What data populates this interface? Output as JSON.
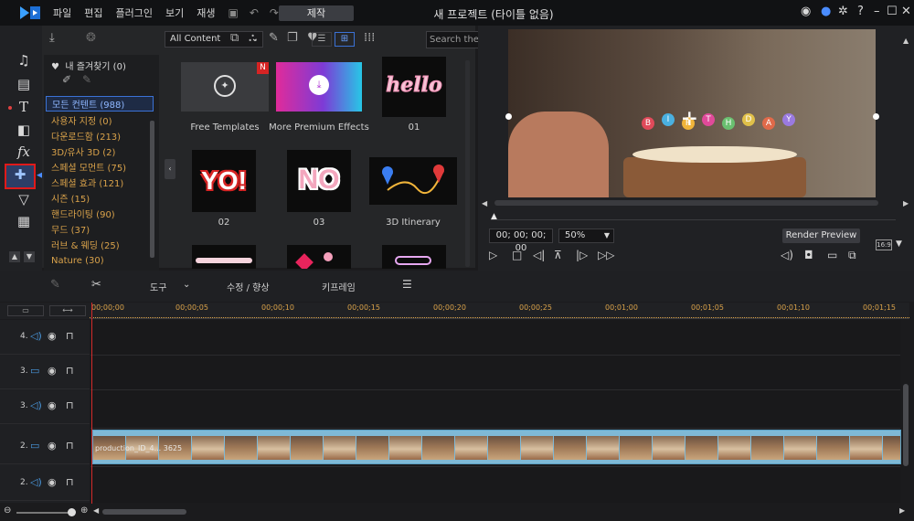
{
  "menu": {
    "file": "파일",
    "edit": "편집",
    "plugins": "플러그인",
    "view": "보기",
    "playback": "재생",
    "produce": "제작"
  },
  "window": {
    "title": "새 프로젝트 (타이틀 없음)"
  },
  "library": {
    "filter": "All Content",
    "search_placeholder": "Search the library",
    "favorites": "내 즐겨찾기 (0)",
    "categories": [
      {
        "label": "모든 컨텐트 (988)",
        "selected": true
      },
      {
        "label": "사용자 지정  (0)"
      },
      {
        "label": "다운로드함  (213)"
      },
      {
        "label": "3D/유사 3D  (2)"
      },
      {
        "label": "스페셜 모먼트  (75)"
      },
      {
        "label": "스페셜 효과  (121)"
      },
      {
        "label": "시즌  (15)"
      },
      {
        "label": "핸드라이팅  (90)"
      },
      {
        "label": "무드  (37)"
      },
      {
        "label": "러브 & 웨딩  (25)"
      },
      {
        "label": "Nature  (30)"
      }
    ],
    "items": [
      {
        "label": "Free Templates",
        "badge": "N"
      },
      {
        "label": "More Premium Effects"
      },
      {
        "label": "01",
        "text": "hello"
      },
      {
        "label": "02",
        "text": "YO!"
      },
      {
        "label": "03",
        "text": "NO"
      },
      {
        "label": "3D Itinerary"
      }
    ]
  },
  "preview": {
    "timecode": "00; 00; 00; 00",
    "zoom": "50%",
    "render": "Render Preview",
    "aspect": "16:9",
    "candles": [
      "B",
      "I",
      "R",
      "T",
      "H",
      "D",
      "A",
      "Y"
    ]
  },
  "toolbar": {
    "tools": "도구",
    "edit": "수정 / 향상",
    "keyframe": "키프레임"
  },
  "timeline": {
    "ticks": [
      "00;00;00",
      "00;00;05",
      "00;00;10",
      "00;00;15",
      "00;00;20",
      "00;00;25",
      "00;01;00",
      "00;01;05",
      "00;01;10",
      "00;01;15"
    ],
    "tracks": [
      {
        "num": "4.",
        "type": "audio"
      },
      {
        "num": "3.",
        "type": "video"
      },
      {
        "num": "3.",
        "type": "audio"
      },
      {
        "num": "2.",
        "type": "video"
      },
      {
        "num": "2.",
        "type": "audio"
      }
    ],
    "clip_label": "production_ID_4... 3625"
  }
}
